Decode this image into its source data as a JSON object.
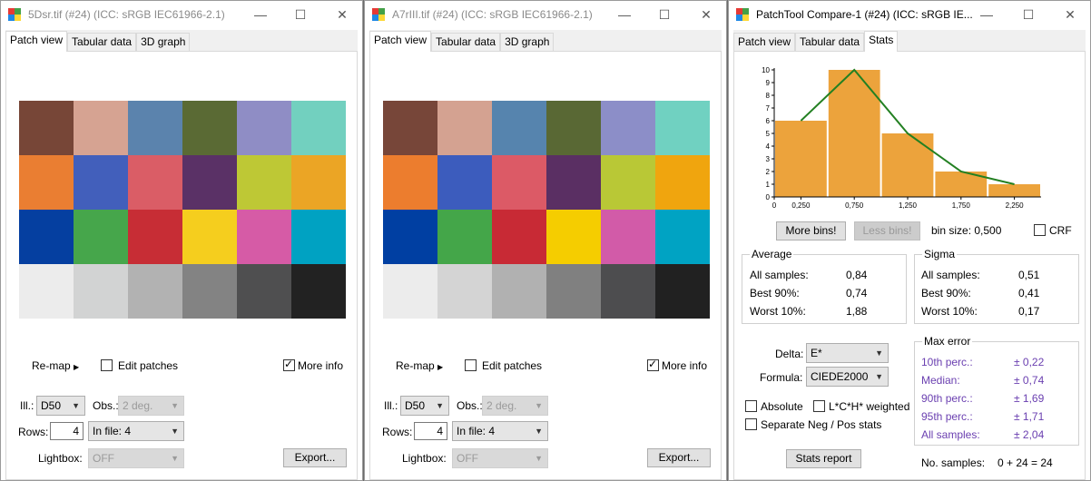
{
  "colors": {
    "patches": [
      "#774637",
      "#d6a392",
      "#5b83ad",
      "#5a6a34",
      "#8f8dc5",
      "#72d0bf",
      "#ea7e32",
      "#425fbb",
      "#da5d66",
      "#5a3166",
      "#bec835",
      "#eba525",
      "#053fa0",
      "#46a64b",
      "#c72d35",
      "#f5ce1e",
      "#d65ba6",
      "#00a2c2",
      "#ececec",
      "#d2d3d3",
      "#b2b2b2",
      "#838383",
      "#4f4f50",
      "#222222"
    ],
    "patches_b": [
      "#774639",
      "#d4a291",
      "#5684ae",
      "#596834",
      "#8c8ec8",
      "#70d1c1",
      "#ec7d2e",
      "#3c5cbd",
      "#dc5a66",
      "#5a2f63",
      "#b9c836",
      "#f0a50e",
      "#003fa2",
      "#44a649",
      "#c82a35",
      "#f5cd00",
      "#d25ba8",
      "#00a3c3",
      "#ececec",
      "#d4d4d4",
      "#b1b1b1",
      "#808080",
      "#4d4d4f",
      "#212121"
    ],
    "histogram_bar": "#eca33c",
    "histogram_line": "#238022"
  },
  "win1": {
    "title": "5Dsr.tif (#24) (ICC: sRGB IEC61966-2.1)",
    "tabs": [
      "Patch view",
      "Tabular data",
      "3D graph"
    ],
    "remap": "Re-map",
    "edit_patches": "Edit patches",
    "more_info": "More info",
    "ill_label": "Ill.:",
    "ill_value": "D50",
    "obs_label": "Obs.:",
    "obs_value": "2 deg.",
    "rows_label": "Rows:",
    "rows_value": "4",
    "infile_value": "In file: 4",
    "lightbox_label": "Lightbox:",
    "lightbox_value": "OFF",
    "export": "Export..."
  },
  "win2": {
    "title": "A7rIII.tif (#24) (ICC: sRGB IEC61966-2.1)",
    "tabs": [
      "Patch view",
      "Tabular data",
      "3D graph"
    ],
    "remap": "Re-map",
    "edit_patches": "Edit patches",
    "more_info": "More info",
    "ill_label": "Ill.:",
    "ill_value": "D50",
    "obs_label": "Obs.:",
    "obs_value": "2 deg.",
    "rows_label": "Rows:",
    "rows_value": "4",
    "infile_value": "In file: 4",
    "lightbox_label": "Lightbox:",
    "lightbox_value": "OFF",
    "export": "Export..."
  },
  "win3": {
    "title": "PatchTool Compare-1 (#24) (ICC: sRGB IE...",
    "tabs": [
      "Patch view",
      "Tabular data",
      "Stats"
    ],
    "more_bins": "More bins!",
    "less_bins": "Less bins!",
    "bin_size": "bin size: 0,500",
    "crf": "CRF",
    "average": {
      "title": "Average",
      "rows": [
        {
          "label": "All samples:",
          "value": "0,84"
        },
        {
          "label": "Best 90%:",
          "value": "0,74"
        },
        {
          "label": "Worst 10%:",
          "value": "1,88"
        }
      ]
    },
    "sigma": {
      "title": "Sigma",
      "rows": [
        {
          "label": "All samples:",
          "value": "0,51"
        },
        {
          "label": "Best 90%:",
          "value": "0,41"
        },
        {
          "label": "Worst 10%:",
          "value": "0,17"
        }
      ]
    },
    "delta_label": "Delta:",
    "delta_value": "E*",
    "formula_label": "Formula:",
    "formula_value": "CIEDE2000",
    "absolute": "Absolute",
    "lch_weighted": "L*C*H* weighted",
    "separate": "Separate Neg / Pos stats",
    "stats_report": "Stats report",
    "max_error": {
      "title": "Max error",
      "rows": [
        {
          "label": "10th perc.:",
          "value": "± 0,22"
        },
        {
          "label": "Median:",
          "value": "± 0,74"
        },
        {
          "label": "90th perc.:",
          "value": "± 1,69"
        },
        {
          "label": "95th perc.:",
          "value": "± 1,71"
        },
        {
          "label": "All samples:",
          "value": "± 2,04"
        }
      ]
    },
    "no_samples_label": "No. samples:",
    "no_samples_value": "0 + 24 = 24"
  },
  "chart_data": {
    "type": "bar",
    "categories": [
      "0,250",
      "0,750",
      "1,250",
      "1,750",
      "2,250"
    ],
    "x_tick_labels": [
      "0",
      "0,250",
      "0,750",
      "1,250",
      "1,750",
      "2,250"
    ],
    "y_tick_labels": [
      "0",
      "1",
      "2",
      "3",
      "4",
      "5",
      "6",
      "7",
      "8",
      "9",
      "10"
    ],
    "series": [
      {
        "values": [
          6,
          10,
          5,
          2,
          1
        ]
      }
    ],
    "line": [
      6,
      10,
      5,
      2,
      1
    ],
    "ylim": [
      0,
      10
    ],
    "xlim": [
      0,
      2.5
    ],
    "grid": false,
    "title": "",
    "xlabel": "",
    "ylabel": ""
  }
}
